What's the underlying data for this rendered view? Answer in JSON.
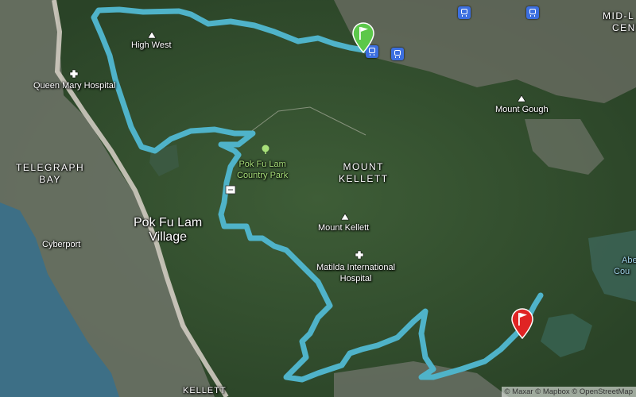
{
  "map": {
    "labels": {
      "high_west": "High West",
      "queen_mary": "Queen Mary Hospital",
      "telegraph_bay_1": "TELEGRAPH",
      "telegraph_bay_2": "BAY",
      "pok_fu_lam_1": "Pok Fu Lam",
      "pok_fu_lam_2": "Village",
      "cyberport": "Cyberport",
      "country_park_1": "Pok Fu Lam",
      "country_park_2": "Country Park",
      "mount_kellett_area_1": "MOUNT",
      "mount_kellett_area_2": "KELLETT",
      "mount_kellett_peak": "Mount Kellett",
      "matilda_1": "Matilda International",
      "matilda_2": "Hospital",
      "mount_gough": "Mount Gough",
      "mid_levels_1": "MID-L",
      "mid_levels_2": "CENT",
      "aberdeen_1": "Abe",
      "aberdeen_2": "Cou",
      "kellett_bottom": "KELLETT"
    },
    "attribution": "© Maxar © Mapbox © OpenStreetMap",
    "colors": {
      "route": "#4fb3c9",
      "start_marker": "#5cc84a",
      "end_marker": "#e02424",
      "park_text": "#a8e07a",
      "water": "#3d6f86"
    },
    "icons": {
      "start": "green-flag-marker-icon",
      "end": "red-flag-marker-icon",
      "peak": "mountain-peak-icon",
      "hospital": "hospital-cross-icon",
      "park": "tree-icon",
      "transit": "bus-icon"
    }
  }
}
